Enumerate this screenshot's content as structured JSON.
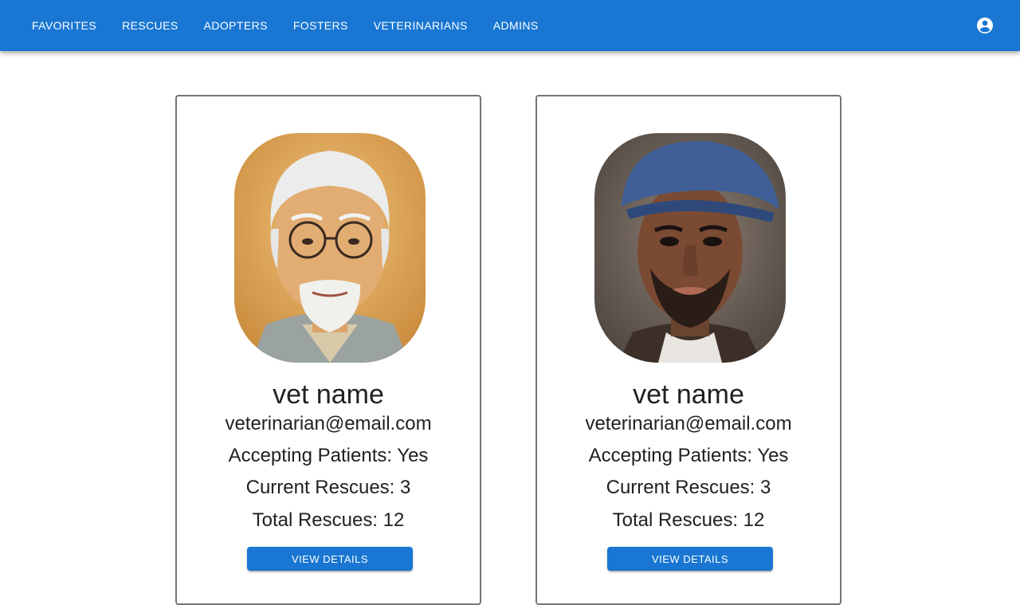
{
  "nav": {
    "items": [
      "FAVORITES",
      "RESCUES",
      "ADOPTERS",
      "FOSTERS",
      "VETERINARIANS",
      "ADMINS"
    ],
    "account_icon": "account-circle-icon"
  },
  "colors": {
    "appbar": "#1976d2",
    "button": "#1976d2",
    "card_border": "#757575",
    "text": "#212121"
  },
  "veterinarians": [
    {
      "name": "vet name",
      "email": "veterinarian@email.com",
      "accepting": "Accepting Patients: Yes",
      "current": "Current Rescues: 3",
      "total": "Total Rescues: 12",
      "button_label": "VIEW DETAILS",
      "photo": "portrait of older man with white hair, glasses and beard"
    },
    {
      "name": "vet name",
      "email": "veterinarian@email.com",
      "accepting": "Accepting Patients: Yes",
      "current": "Current Rescues: 3",
      "total": "Total Rescues: 12",
      "button_label": "VIEW DETAILS",
      "photo": "portrait of man with blue flat cap and beard"
    }
  ]
}
